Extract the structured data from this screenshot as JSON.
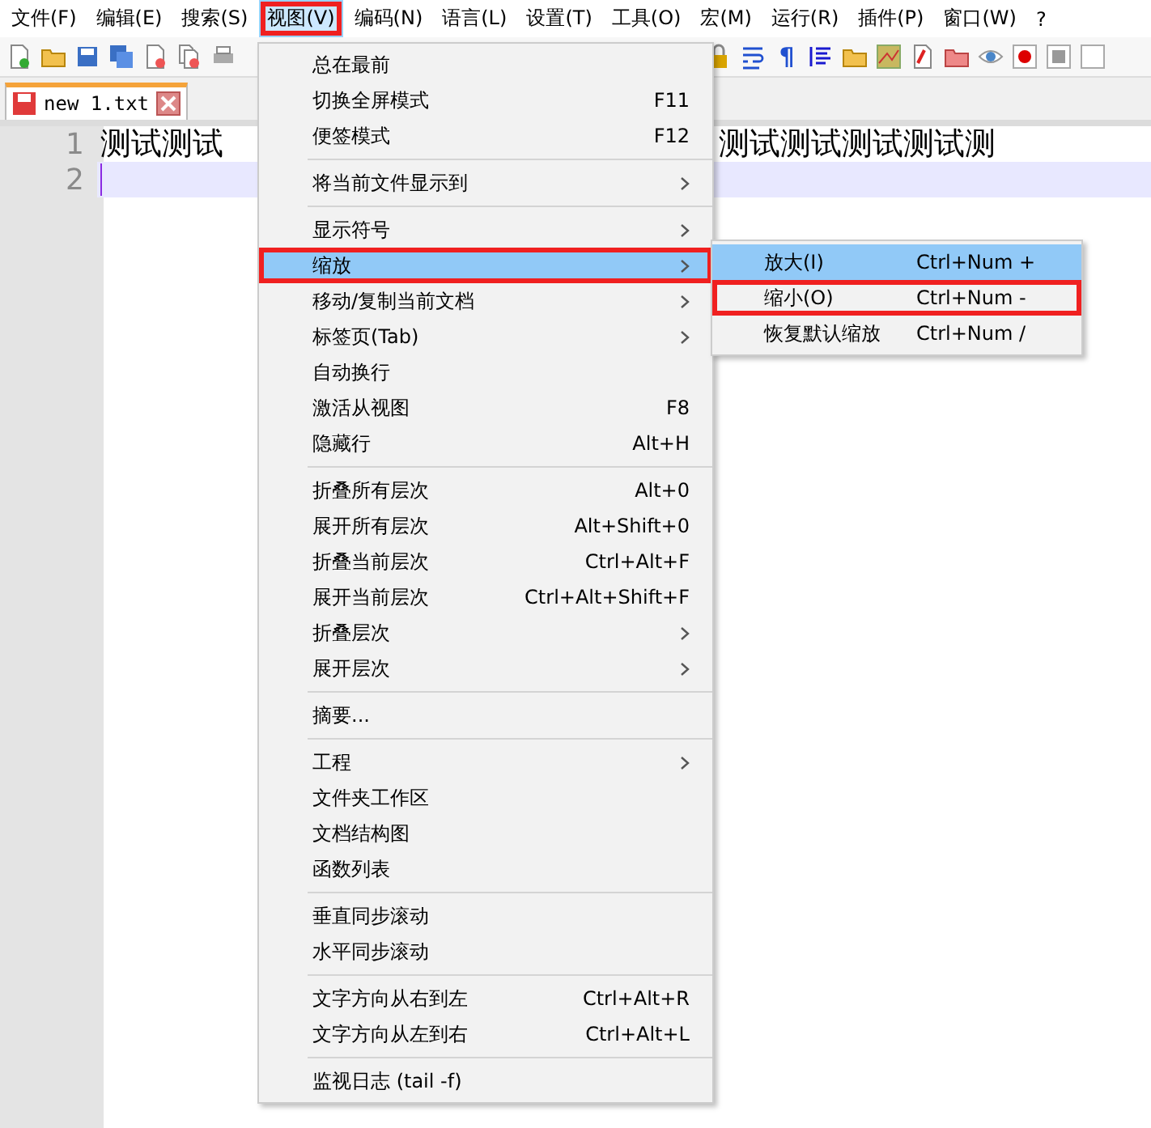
{
  "menubar": [
    {
      "label": "文件(F)",
      "selected": false,
      "annotated": false
    },
    {
      "label": "编辑(E)",
      "selected": false,
      "annotated": false
    },
    {
      "label": "搜索(S)",
      "selected": false,
      "annotated": false
    },
    {
      "label": "视图(V)",
      "selected": true,
      "annotated": true
    },
    {
      "label": "编码(N)",
      "selected": false,
      "annotated": false
    },
    {
      "label": "语言(L)",
      "selected": false,
      "annotated": false
    },
    {
      "label": "设置(T)",
      "selected": false,
      "annotated": false
    },
    {
      "label": "工具(O)",
      "selected": false,
      "annotated": false
    },
    {
      "label": "宏(M)",
      "selected": false,
      "annotated": false
    },
    {
      "label": "运行(R)",
      "selected": false,
      "annotated": false
    },
    {
      "label": "插件(P)",
      "selected": false,
      "annotated": false
    },
    {
      "label": "窗口(W)",
      "selected": false,
      "annotated": false
    },
    {
      "label": "?",
      "selected": false,
      "annotated": false
    }
  ],
  "toolbar": {
    "pilcrow": "¶"
  },
  "tabs": [
    {
      "label": "new 1.txt",
      "selected": true
    }
  ],
  "editor": {
    "lines": [
      {
        "number": "1",
        "segments": [
          "测试测试",
          "测试测试测试测试测"
        ],
        "current": false
      },
      {
        "number": "2",
        "current": true
      }
    ]
  },
  "menu": {
    "items": [
      {
        "kind": "item",
        "label": "总在最前",
        "selected": false,
        "annotated": false,
        "submenu": false
      },
      {
        "kind": "item",
        "label": "切换全屏模式",
        "shortcut": "F11",
        "selected": false,
        "annotated": false,
        "submenu": false
      },
      {
        "kind": "item",
        "label": "便签模式",
        "shortcut": "F12",
        "selected": false,
        "annotated": false,
        "submenu": false
      },
      {
        "kind": "separator"
      },
      {
        "kind": "item",
        "label": "将当前文件显示到",
        "selected": false,
        "annotated": false,
        "submenu": true
      },
      {
        "kind": "separator"
      },
      {
        "kind": "item",
        "label": "显示符号",
        "selected": false,
        "annotated": false,
        "submenu": true
      },
      {
        "kind": "item",
        "label": "缩放",
        "selected": true,
        "annotated": true,
        "submenu": true
      },
      {
        "kind": "item",
        "label": "移动/复制当前文档",
        "selected": false,
        "annotated": false,
        "submenu": true
      },
      {
        "kind": "item",
        "label": "标签页(Tab)",
        "selected": false,
        "annotated": false,
        "submenu": true
      },
      {
        "kind": "item",
        "label": "自动换行",
        "selected": false,
        "annotated": false,
        "submenu": false
      },
      {
        "kind": "item",
        "label": "激活从视图",
        "shortcut": "F8",
        "selected": false,
        "annotated": false,
        "submenu": false
      },
      {
        "kind": "item",
        "label": "隐藏行",
        "shortcut": "Alt+H",
        "selected": false,
        "annotated": false,
        "submenu": false
      },
      {
        "kind": "separator"
      },
      {
        "kind": "item",
        "label": "折叠所有层次",
        "shortcut": "Alt+0",
        "selected": false,
        "annotated": false,
        "submenu": false
      },
      {
        "kind": "item",
        "label": "展开所有层次",
        "shortcut": "Alt+Shift+0",
        "selected": false,
        "annotated": false,
        "submenu": false
      },
      {
        "kind": "item",
        "label": "折叠当前层次",
        "shortcut": "Ctrl+Alt+F",
        "selected": false,
        "annotated": false,
        "submenu": false
      },
      {
        "kind": "item",
        "label": "展开当前层次",
        "shortcut": "Ctrl+Alt+Shift+F",
        "selected": false,
        "annotated": false,
        "submenu": false
      },
      {
        "kind": "item",
        "label": "折叠层次",
        "selected": false,
        "annotated": false,
        "submenu": true
      },
      {
        "kind": "item",
        "label": "展开层次",
        "selected": false,
        "annotated": false,
        "submenu": true
      },
      {
        "kind": "separator"
      },
      {
        "kind": "item",
        "label": "摘要...",
        "selected": false,
        "annotated": false,
        "submenu": false
      },
      {
        "kind": "separator"
      },
      {
        "kind": "item",
        "label": "工程",
        "selected": false,
        "annotated": false,
        "submenu": true
      },
      {
        "kind": "item",
        "label": "文件夹工作区",
        "selected": false,
        "annotated": false,
        "submenu": false
      },
      {
        "kind": "item",
        "label": "文档结构图",
        "selected": false,
        "annotated": false,
        "submenu": false
      },
      {
        "kind": "item",
        "label": "函数列表",
        "selected": false,
        "annotated": false,
        "submenu": false
      },
      {
        "kind": "separator"
      },
      {
        "kind": "item",
        "label": "垂直同步滚动",
        "selected": false,
        "annotated": false,
        "submenu": false
      },
      {
        "kind": "item",
        "label": "水平同步滚动",
        "selected": false,
        "annotated": false,
        "submenu": false
      },
      {
        "kind": "separator"
      },
      {
        "kind": "item",
        "label": "文字方向从右到左",
        "shortcut": "Ctrl+Alt+R",
        "selected": false,
        "annotated": false,
        "submenu": false
      },
      {
        "kind": "item",
        "label": "文字方向从左到右",
        "shortcut": "Ctrl+Alt+L",
        "selected": false,
        "annotated": false,
        "submenu": false
      },
      {
        "kind": "separator"
      },
      {
        "kind": "item",
        "label": "监视日志 (tail -f)",
        "selected": false,
        "annotated": false,
        "submenu": false
      }
    ]
  },
  "submenu": {
    "items": [
      {
        "kind": "item",
        "label": "放大(I)",
        "shortcut": "Ctrl+Num +",
        "selected": true,
        "annotated": false,
        "submenu": false
      },
      {
        "kind": "item",
        "label": "缩小(O)",
        "shortcut": "Ctrl+Num -",
        "selected": false,
        "annotated": true,
        "submenu": false
      },
      {
        "kind": "item",
        "label": "恢复默认缩放",
        "shortcut": "Ctrl+Num /",
        "selected": false,
        "annotated": false,
        "submenu": false
      }
    ]
  }
}
